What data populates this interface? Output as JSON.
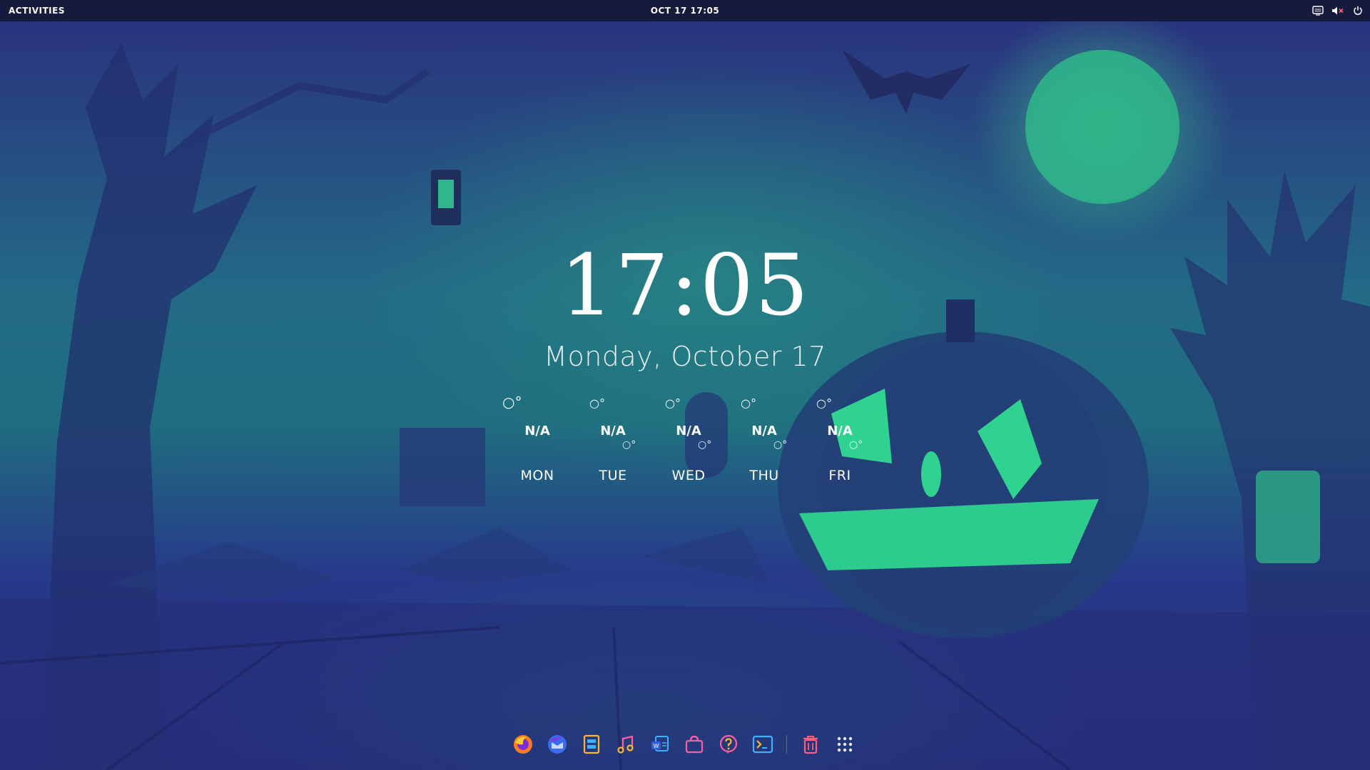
{
  "topbar": {
    "activities_label": "ACTIVITIES",
    "datetime": "OCT 17  17:05",
    "tray": {
      "icons": [
        "screen-icon",
        "volume-muted-icon",
        "power-icon"
      ]
    }
  },
  "lockscreen": {
    "time": "17:05",
    "date": "Monday, October 17"
  },
  "forecast": {
    "days": [
      {
        "name": "MON",
        "temp": "N/A",
        "deg_top": "○°",
        "deg_bottom": ""
      },
      {
        "name": "TUE",
        "temp": "N/A",
        "deg_top": "○°",
        "deg_bottom": "○°"
      },
      {
        "name": "WED",
        "temp": "N/A",
        "deg_top": "○°",
        "deg_bottom": "○°"
      },
      {
        "name": "THU",
        "temp": "N/A",
        "deg_top": "○°",
        "deg_bottom": "○°"
      },
      {
        "name": "FRI",
        "temp": "N/A",
        "deg_top": "○°",
        "deg_bottom": "○°"
      }
    ]
  },
  "dock": {
    "apps": [
      "firefox-icon",
      "thunderbird-icon",
      "files-icon",
      "music-icon",
      "writer-icon",
      "software-store-icon",
      "help-icon",
      "terminal-icon",
      "trash-icon",
      "show-apps-icon"
    ]
  },
  "colors": {
    "topbar_bg": "#161a3c",
    "accent_green": "#2ecf8c",
    "bg_blue": "#2a2f7e"
  }
}
